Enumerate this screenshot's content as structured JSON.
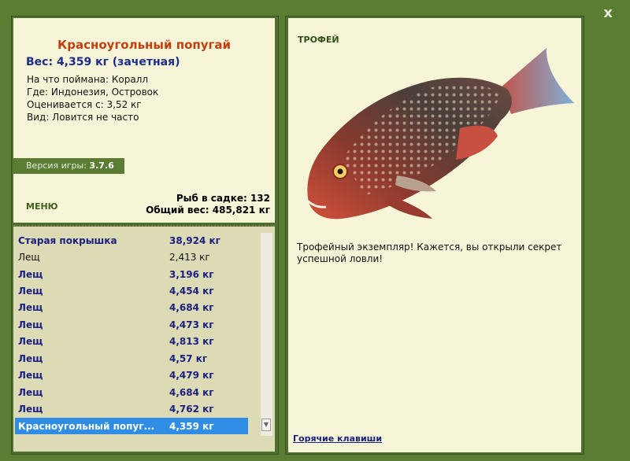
{
  "window": {
    "close_label": "x"
  },
  "fish": {
    "name": "Красноугольный попугай",
    "weight": "Вес: 4,359 кг (зачетная)",
    "caught_on": "На что поймана: Коралл",
    "location": "Где: Индонезия, Островок",
    "value": "Оценивается с: 3,52 кг",
    "rarity": "Вид: Ловится не часто"
  },
  "version": {
    "label": "Версия игры:",
    "value": "3.7.6"
  },
  "menu_label": "МЕНЮ",
  "stats": {
    "count": "Рыб в садке: 132",
    "total": "Общий вес: 485,821 кг"
  },
  "catch_list": [
    {
      "name": "Старая покрышка",
      "weight": "38,924 кг",
      "bold": true
    },
    {
      "name": "Лещ",
      "weight": "2,413 кг",
      "bold": false
    },
    {
      "name": "Лещ",
      "weight": "3,196 кг",
      "bold": true
    },
    {
      "name": "Лещ",
      "weight": "4,454 кг",
      "bold": true
    },
    {
      "name": "Лещ",
      "weight": "4,684 кг",
      "bold": true
    },
    {
      "name": "Лещ",
      "weight": "4,473 кг",
      "bold": true
    },
    {
      "name": "Лещ",
      "weight": "4,813 кг",
      "bold": true
    },
    {
      "name": "Лещ",
      "weight": "4,57 кг",
      "bold": true
    },
    {
      "name": "Лещ",
      "weight": "4,479 кг",
      "bold": true
    },
    {
      "name": "Лещ",
      "weight": "4,684 кг",
      "bold": true
    },
    {
      "name": "Лещ",
      "weight": "4,762 кг",
      "bold": true
    },
    {
      "name": "Красноугольный попуг...",
      "weight": "4,359 кг",
      "bold": true,
      "selected": true
    }
  ],
  "trophy": {
    "badge": "ТРОФЕЙ",
    "description": "Трофейный экземпляр! Кажется, вы открыли секрет успешной ловли!"
  },
  "hotkeys_label": "Горячие клавиши",
  "scroll_arrow": "▼",
  "colors": {
    "frame": "#5a7d33",
    "panel": "#f6f5d8",
    "list_bg": "#dddab6",
    "selection": "#2f8de6",
    "accent_text": "#1a2080",
    "title": "#c04010"
  }
}
